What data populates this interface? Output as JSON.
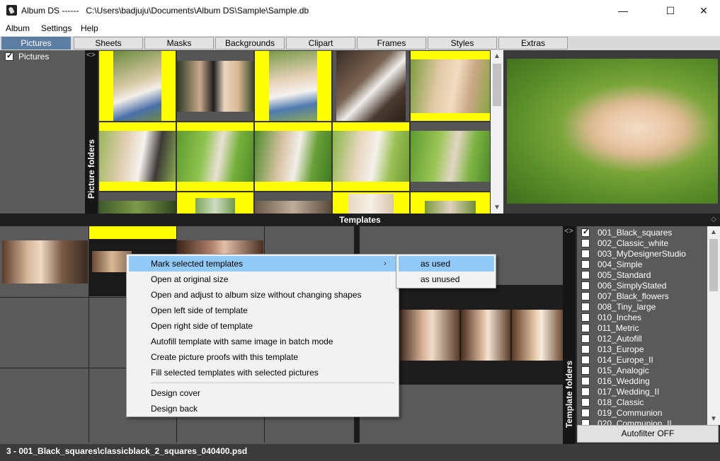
{
  "window": {
    "title": "Album DS ------   C:\\Users\\badjuju\\Documents\\Album DS\\Sample\\Sample.db",
    "minimize": "—",
    "maximize": "☐",
    "close": "✕"
  },
  "menu": [
    "Album",
    "Settings",
    "Help"
  ],
  "tabs": [
    "Pictures",
    "Sheets",
    "Masks",
    "Backgrounds",
    "Clipart",
    "Frames",
    "Styles",
    "Extras"
  ],
  "active_tab": "Pictures",
  "left_panel": {
    "item_label": "Pictures",
    "checked": true
  },
  "picture_folders_label": "Picture folders",
  "templates_header": "Templates",
  "template_folders_label": "Template folders",
  "template_list": [
    {
      "label": "001_Black_squares",
      "checked": true
    },
    {
      "label": "002_Classic_white",
      "checked": false
    },
    {
      "label": "003_MyDesignerStudio",
      "checked": false
    },
    {
      "label": "004_Simple",
      "checked": false
    },
    {
      "label": "005_Standard",
      "checked": false
    },
    {
      "label": "006_SimplyStated",
      "checked": false
    },
    {
      "label": "007_Black_flowers",
      "checked": false
    },
    {
      "label": "008_Tiny_large",
      "checked": false
    },
    {
      "label": "010_Inches",
      "checked": false
    },
    {
      "label": "011_Metric",
      "checked": false
    },
    {
      "label": "012_Autofill",
      "checked": false
    },
    {
      "label": "013_Europe",
      "checked": false
    },
    {
      "label": "014_Europe_II",
      "checked": false
    },
    {
      "label": "015_Analogic",
      "checked": false
    },
    {
      "label": "016_Wedding",
      "checked": false
    },
    {
      "label": "017_Wedding_II",
      "checked": false
    },
    {
      "label": "018_Classic",
      "checked": false
    },
    {
      "label": "019_Communion",
      "checked": false
    },
    {
      "label": "020_Communion_II",
      "checked": false
    }
  ],
  "autofilter_label": "Autofilter OFF",
  "status_text": "3 - 001_Black_squares\\classicblack_2_squares_040400.psd",
  "context_menu": {
    "items": [
      "Mark selected templates",
      "Open at original size",
      "Open and adjust to album size without changing shapes",
      "Open left side of template",
      "Open right side of template",
      "Autofill template with same image in batch mode",
      "Create picture proofs with this template",
      "Fill selected templates with selected pictures",
      "Design cover",
      "Design back"
    ],
    "submenu_arrow": "›",
    "submenu": [
      "as used",
      "as unused"
    ]
  },
  "colors": {
    "accent_tab": "#5c7ea3",
    "highlight": "#91c9f7",
    "selection_yellow": "#ffff00"
  }
}
